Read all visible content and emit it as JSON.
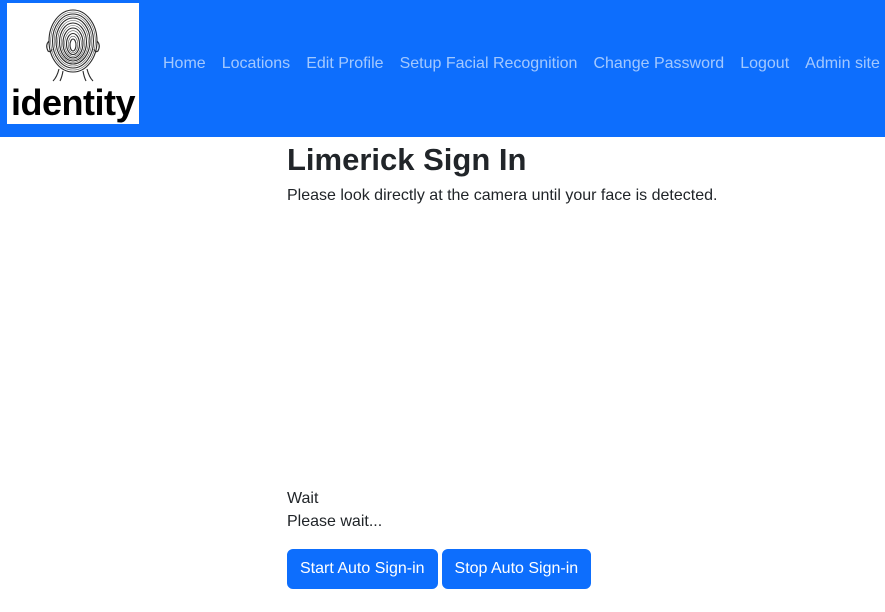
{
  "navbar": {
    "logo_text": "identity",
    "logo_icon": "fingerprint-head-icon",
    "accent_color": "#0d6efd",
    "links": [
      {
        "label": "Home"
      },
      {
        "label": "Locations"
      },
      {
        "label": "Edit Profile"
      },
      {
        "label": "Setup Facial Recognition"
      },
      {
        "label": "Change Password"
      },
      {
        "label": "Logout"
      },
      {
        "label": "Admin site"
      }
    ]
  },
  "main": {
    "title": "Limerick Sign In",
    "instructions": "Please look directly at the camera until your face is detected.",
    "status": "Wait",
    "message": "Please wait...",
    "buttons": {
      "start_label": "Start Auto Sign-in",
      "stop_label": "Stop Auto Sign-in"
    }
  }
}
